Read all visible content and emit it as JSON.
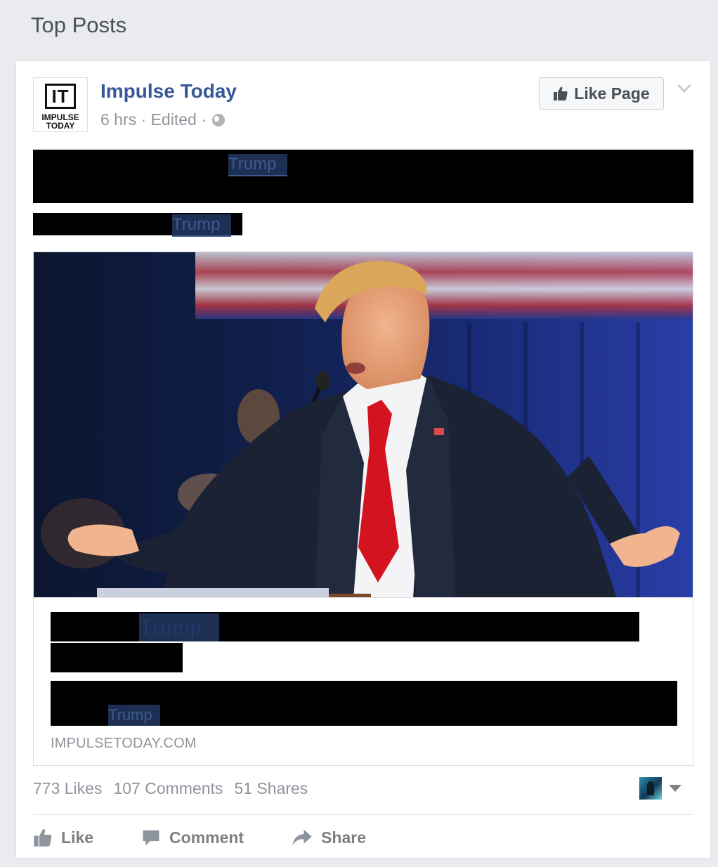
{
  "section": {
    "title": "Top Posts"
  },
  "post": {
    "logo": {
      "letters": "IT",
      "line1": "IMPULSE",
      "line2": "TODAY"
    },
    "page_name": "Impulse Today",
    "meta": {
      "time": "6 hrs",
      "edited": "Edited",
      "separator": "·"
    },
    "like_page_label": "Like Page",
    "text_highlights": [
      "Trump",
      "Trump"
    ],
    "link": {
      "title_highlight": "Trump",
      "desc_highlight": "Trump",
      "domain": "IMPULSETODAY.COM"
    },
    "stats": {
      "likes": "773 Likes",
      "comments": "107 Comments",
      "shares": "51 Shares"
    },
    "actions": {
      "like": "Like",
      "comment": "Comment",
      "share": "Share"
    }
  },
  "colors": {
    "link_blue": "#365899",
    "meta_grey": "#90949c",
    "background": "#e9ebee"
  }
}
